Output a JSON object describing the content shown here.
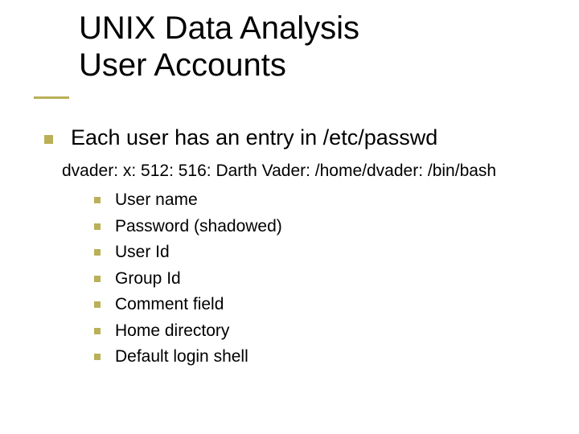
{
  "title_line1": "UNIX Data Analysis",
  "title_line2": "User Accounts",
  "main_point": "Each user has an entry in /etc/passwd",
  "example_line": "dvader: x: 512: 516: Darth Vader: /home/dvader: /bin/bash",
  "fields": [
    "User name",
    "Password (shadowed)",
    "User Id",
    "Group Id",
    "Comment field",
    "Home directory",
    "Default login shell"
  ]
}
